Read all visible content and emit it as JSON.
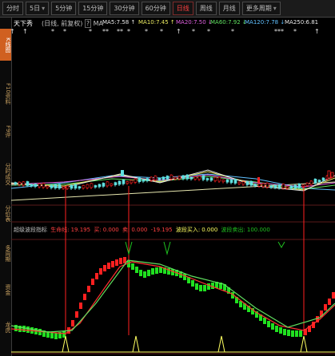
{
  "tabs": [
    {
      "label": "分时",
      "active": false,
      "dropdown": false
    },
    {
      "label": "5日",
      "active": false,
      "dropdown": true
    },
    {
      "label": "5分钟",
      "active": false,
      "dropdown": false
    },
    {
      "label": "15分钟",
      "active": false,
      "dropdown": false
    },
    {
      "label": "30分钟",
      "active": false,
      "dropdown": false
    },
    {
      "label": "60分钟",
      "active": false,
      "dropdown": false
    },
    {
      "label": "日线",
      "active": true,
      "dropdown": false
    },
    {
      "label": "周线",
      "active": false,
      "dropdown": false
    },
    {
      "label": "月线",
      "active": false,
      "dropdown": false
    },
    {
      "label": "更多周期",
      "active": false,
      "dropdown": true
    }
  ],
  "sidebar": [
    {
      "label": "K线图",
      "active": true
    },
    {
      "label": "F10资料",
      "active": false
    },
    {
      "label": "F9评",
      "active": false
    },
    {
      "label": "分时成交",
      "active": false
    },
    {
      "label": "分价表",
      "active": false
    },
    {
      "label": "多周期",
      "active": false
    },
    {
      "label": "资金",
      "active": false
    },
    {
      "label": "龙虎",
      "active": false
    }
  ],
  "stock": {
    "name": "天下秀",
    "adjust": "(日线, 前复权)",
    "help": "?",
    "ma_label": "MA"
  },
  "ma": [
    {
      "label": "MA5",
      "value": "7.58",
      "arrow": "↑",
      "color": "#e8e8e8"
    },
    {
      "label": "MA10",
      "value": "7.45",
      "arrow": "↑",
      "color": "#e8e860"
    },
    {
      "label": "MA20",
      "value": "7.50",
      "arrow": "↓",
      "color": "#e060e0"
    },
    {
      "label": "MA60",
      "value": "7.92",
      "arrow": "↓",
      "color": "#60e060"
    },
    {
      "label": "MA120",
      "value": "7.78",
      "arrow": "↓",
      "color": "#60c0ff"
    },
    {
      "label": "MA250",
      "value": "6.81",
      "arrow": "",
      "color": "#e8e8e8"
    }
  ],
  "markers": [
    "↑",
    "↑",
    "*",
    "*",
    "*",
    "**",
    "**",
    "*",
    "*",
    "*",
    "↑",
    "*",
    "*",
    "*",
    "***",
    "*",
    "↑"
  ],
  "indicator": {
    "title": "超级波段指标",
    "life_line_label": "生命线:",
    "life_line_value": "19.195",
    "buy_label": "买:",
    "buy_value": "0.000",
    "sell_label": "卖:",
    "sell_value": "0.000",
    "extra_value": "-19.195",
    "band_buy_label": "波段买入:",
    "band_buy_value": "0.000",
    "band_sell_label": "波段卖出:",
    "band_sell_value": "100.000"
  },
  "colors": {
    "up": "#ff2020",
    "down": "#20e020",
    "life_line": "#ff3030",
    "signal": "#ffff60",
    "accent": "#ff4040"
  }
}
